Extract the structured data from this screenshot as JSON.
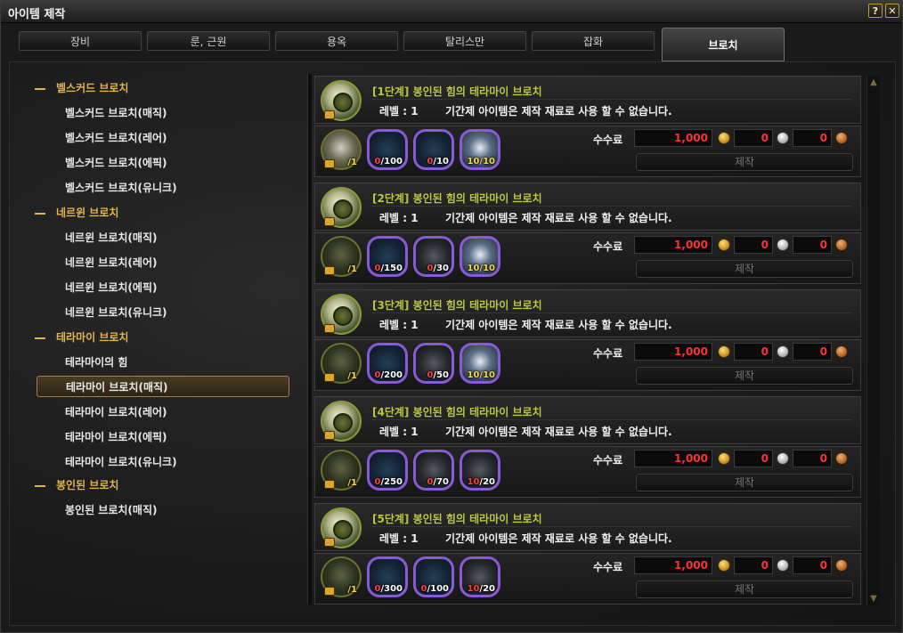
{
  "window": {
    "title": "아이템 제작",
    "help_label": "?",
    "close_label": "✕"
  },
  "tabs": [
    {
      "label": "장비"
    },
    {
      "label": "룬, 근원"
    },
    {
      "label": "용옥"
    },
    {
      "label": "탈리스만"
    },
    {
      "label": "잡화"
    },
    {
      "label": "브로치",
      "active": true
    }
  ],
  "sidebar": {
    "categories": [
      {
        "label": "벨스커드 브로치",
        "items": [
          "벨스커드 브로치(매직)",
          "벨스커드 브로치(레어)",
          "벨스커드 브로치(에픽)",
          "벨스커드 브로치(유니크)"
        ]
      },
      {
        "label": "네르윈 브로치",
        "items": [
          "네르윈 브로치(매직)",
          "네르윈 브로치(레어)",
          "네르윈 브로치(에픽)",
          "네르윈 브로치(유니크)"
        ]
      },
      {
        "label": "테라마이 브로치",
        "items": [
          "테라마이의 힘",
          "테라마이 브로치(매직)",
          "테라마이 브로치(레어)",
          "테라마이 브로치(에픽)",
          "테라마이 브로치(유니크)"
        ]
      },
      {
        "label": "봉인된 브로치",
        "items": [
          "봉인된 브로치(매직)"
        ]
      }
    ],
    "selected": "테라마이 브로치(매직)"
  },
  "recipes": [
    {
      "title": "[1단계] 봉인된 힘의 테라마이 브로치",
      "level": "레벨 : 1",
      "note": "기간제 아이템은 제작 재료로 사용 할 수 없습니다.",
      "materials": [
        {
          "have": "",
          "need": "/1",
          "style": "base",
          "ok": false
        },
        {
          "have": "0",
          "need": "/100",
          "style": "purple",
          "ok": false
        },
        {
          "have": "0",
          "need": "/10",
          "style": "purple",
          "ok": false
        },
        {
          "have": "10",
          "need": "/10",
          "style": "wing",
          "ok": true
        }
      ],
      "fee_label": "수수료",
      "gold": "1,000",
      "silver": "0",
      "bronze": "0",
      "craft_label": "제작"
    },
    {
      "title": "[2단계] 봉인된 힘의 테라마이 브로치",
      "level": "레벨 : 1",
      "note": "기간제 아이템은 제작 재료로 사용 할 수 없습니다.",
      "materials": [
        {
          "have": "",
          "need": "/1",
          "style": "base-dim",
          "ok": false
        },
        {
          "have": "0",
          "need": "/150",
          "style": "purple",
          "ok": false
        },
        {
          "have": "0",
          "need": "/30",
          "style": "dark",
          "ok": false
        },
        {
          "have": "10",
          "need": "/10",
          "style": "wing",
          "ok": true
        }
      ],
      "fee_label": "수수료",
      "gold": "1,000",
      "silver": "0",
      "bronze": "0",
      "craft_label": "제작"
    },
    {
      "title": "[3단계] 봉인된 힘의 테라마이 브로치",
      "level": "레벨 : 1",
      "note": "기간제 아이템은 제작 재료로 사용 할 수 없습니다.",
      "materials": [
        {
          "have": "",
          "need": "/1",
          "style": "base-dim",
          "ok": false
        },
        {
          "have": "0",
          "need": "/200",
          "style": "purple",
          "ok": false
        },
        {
          "have": "0",
          "need": "/50",
          "style": "dark",
          "ok": false
        },
        {
          "have": "10",
          "need": "/10",
          "style": "wing",
          "ok": true
        }
      ],
      "fee_label": "수수료",
      "gold": "1,000",
      "silver": "0",
      "bronze": "0",
      "craft_label": "제작"
    },
    {
      "title": "[4단계] 봉인된 힘의 테라마이 브로치",
      "level": "레벨 : 1",
      "note": "기간제 아이템은 제작 재료로 사용 할 수 없습니다.",
      "materials": [
        {
          "have": "",
          "need": "/1",
          "style": "base-dim",
          "ok": false
        },
        {
          "have": "0",
          "need": "/250",
          "style": "purple",
          "ok": false
        },
        {
          "have": "0",
          "need": "/70",
          "style": "dark",
          "ok": false
        },
        {
          "have": "10",
          "need": "/20",
          "style": "dark",
          "ok": false
        }
      ],
      "fee_label": "수수료",
      "gold": "1,000",
      "silver": "0",
      "bronze": "0",
      "craft_label": "제작"
    },
    {
      "title": "[5단계] 봉인된 힘의 테라마이 브로치",
      "level": "레벨 : 1",
      "note": "기간제 아이템은 제작 재료로 사용 할 수 없습니다.",
      "materials": [
        {
          "have": "",
          "need": "/1",
          "style": "base-dim",
          "ok": false
        },
        {
          "have": "0",
          "need": "/300",
          "style": "purple",
          "ok": false
        },
        {
          "have": "0",
          "need": "/100",
          "style": "purple",
          "ok": false
        },
        {
          "have": "10",
          "need": "/20",
          "style": "dark",
          "ok": false
        }
      ],
      "fee_label": "수수료",
      "gold": "1,000",
      "silver": "0",
      "bronze": "0",
      "craft_label": "제작"
    }
  ],
  "colors": {
    "category": "#e0b54a",
    "recipe_title": "#b8c93a",
    "fee_red": "#ff3030",
    "purple_frame": "#8a59d6"
  },
  "icons": {
    "help": "question-icon",
    "close": "close-icon",
    "gold": "gold-coin-icon",
    "silver": "silver-coin-icon",
    "bronze": "bronze-coin-icon",
    "scroll_up": "scroll-up-arrow-icon",
    "scroll_down": "scroll-down-arrow-icon"
  }
}
